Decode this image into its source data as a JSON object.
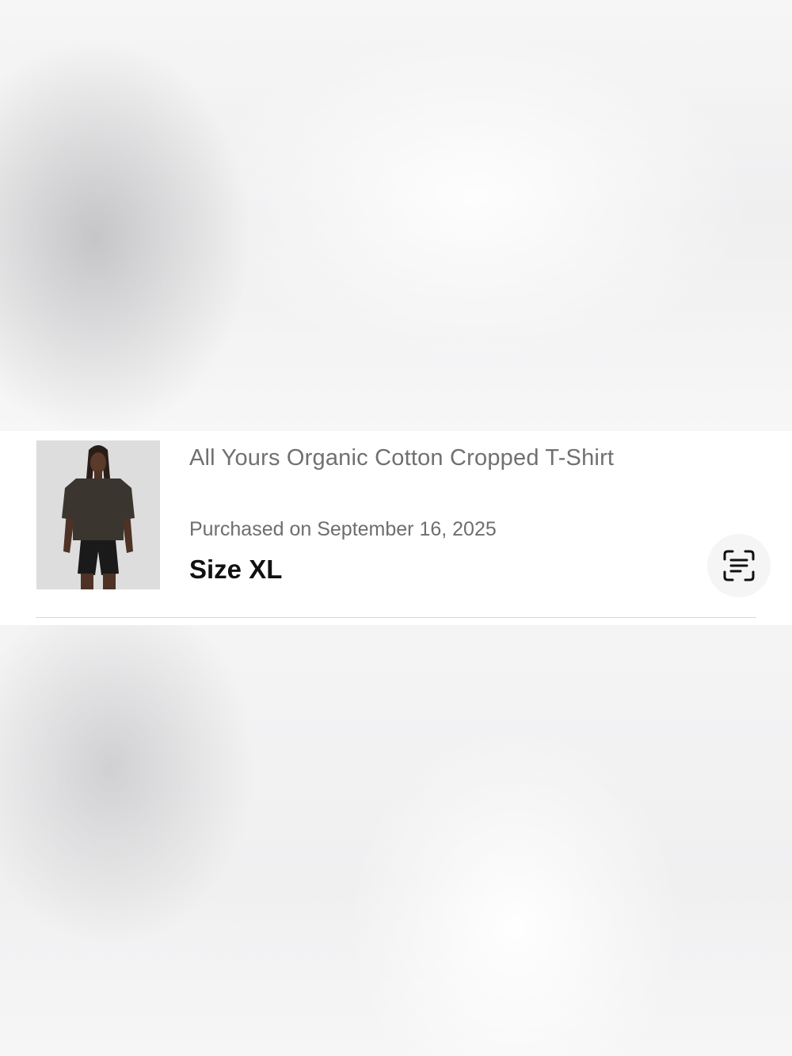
{
  "product": {
    "title": "All Yours Organic Cotton Cropped T-Shirt",
    "purchased": "Purchased on September 16, 2025",
    "size": "Size XL",
    "thumbnail_icon": "product-photo",
    "action_icon": "scan-text-icon"
  },
  "colors": {
    "card_background": "#ffffff",
    "title_text": "#707070",
    "size_text": "#111111",
    "divider": "#d7d7d7"
  }
}
